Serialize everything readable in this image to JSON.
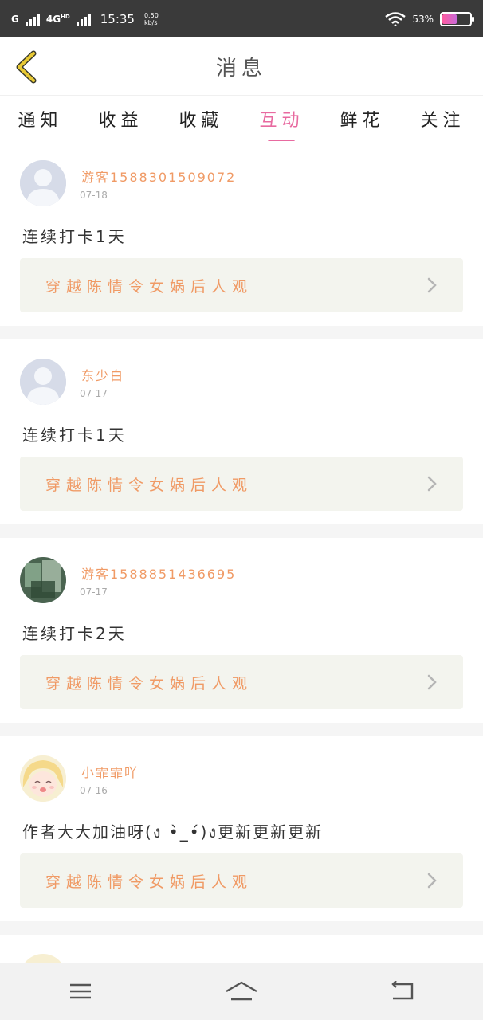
{
  "status_bar": {
    "network_g": "G",
    "network_4g": "4G",
    "hd": "HD",
    "time": "15:35",
    "speed_value": "0.50",
    "speed_unit": "kb/s",
    "battery_text": "53%",
    "battery_level": 0.53
  },
  "header": {
    "title": "消息"
  },
  "tabs": [
    {
      "label": "通知",
      "active": false
    },
    {
      "label": "收益",
      "active": false
    },
    {
      "label": "收藏",
      "active": false
    },
    {
      "label": "互动",
      "active": true
    },
    {
      "label": "鲜花",
      "active": false
    },
    {
      "label": "关注",
      "active": false
    }
  ],
  "posts": [
    {
      "user": "游客15883015090​72",
      "date": "07-18",
      "text": "连续打卡1天",
      "book": "穿越陈情令女娲后人观",
      "avatar": "default-avatar"
    },
    {
      "user": "东少白",
      "date": "07-17",
      "text": "连续打卡1天",
      "book": "穿越陈情令女娲后人观",
      "avatar": "default-avatar"
    },
    {
      "user": "游客15888514366​95",
      "date": "07-17",
      "text": "连续打卡2天",
      "book": "穿越陈情令女娲后人观",
      "avatar": "photo-avatar"
    },
    {
      "user": "小霏霏吖",
      "date": "07-16",
      "text": "作者大大加油呀(ง •̀_•́)ง更新更新更新",
      "book": "穿越陈情令女娲后人观",
      "avatar": "anime-avatar"
    }
  ],
  "icons": {
    "back": "chevron-left-icon",
    "book_link": "chevron-right-icon",
    "menu": "menu-icon",
    "home": "home-icon",
    "back_nav": "return-icon"
  },
  "colors": {
    "accent": "#e86aa0",
    "name": "#f09a65",
    "back_icon": "#e8c934"
  }
}
